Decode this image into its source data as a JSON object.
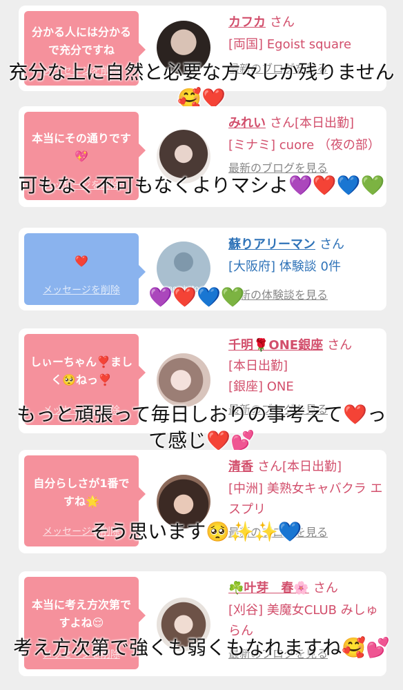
{
  "cards": [
    {
      "message": "分かる人には分かるで充分ですね",
      "delete_label": "メッセージを削除",
      "name": "カフカ",
      "suffix": "さん",
      "lines": [
        "[両国] Egoist square"
      ],
      "link": "最新のブログを見る",
      "overlay": "充分な上に自然と必要な方々しか残りません🥰❤️"
    },
    {
      "message": "本当にその通りです💖",
      "delete_label": "メッセージを削除",
      "name": "みれい",
      "suffix": "さん[本日出勤]",
      "lines": [
        "[ミナミ] cuore （夜の部）"
      ],
      "link": "最新のブログを見る",
      "overlay": "可もなく不可もなくよりマシよ💜❤️💙💚"
    },
    {
      "message": "❤️",
      "delete_label": "メッセージを削除",
      "name": "蘇りアリーマン",
      "suffix": "さん",
      "lines": [
        "[大阪府] 体験談 0件"
      ],
      "link": "最新の体験談を見る",
      "overlay": "💜❤️💙💚",
      "avatar_text": "no photo"
    },
    {
      "message": "しぃーちゃん❣️ましく🥺ねっ❣️",
      "delete_label": "メッセージを削除",
      "name": "千明🌹ONE銀座",
      "suffix": "さん",
      "lines": [
        "[本日出勤]",
        "[銀座] ONE"
      ],
      "link": "最新のブログを見る",
      "overlay": "もっと頑張って毎日しおりの事考えて❤️って感じ❤️💕"
    },
    {
      "message": "自分らしさが1番ですね🌟",
      "delete_label": "メッセージを削除",
      "name": "清香",
      "suffix": "さん[本日出勤]",
      "lines": [
        "[中洲] 美熟女キャバクラ エスプリ"
      ],
      "link": "最新のブログを見る",
      "overlay": "そう思います🥺✨✨💙"
    },
    {
      "message": "本当に考え方次第ですよね😌",
      "delete_label": "メッセージを削除",
      "name": "☘️叶芽　春🌸",
      "suffix": "さん",
      "lines": [
        "[刈谷] 美魔女CLUB みしゅらん"
      ],
      "link": "最新のブログを見る",
      "overlay": "考え方次第で強くも弱くもなれますね🥰💕"
    }
  ],
  "colors": {
    "pink_bubble": "#f5919c",
    "blue_bubble": "#8ab3ee",
    "name_pink": "#d24f6c",
    "name_blue": "#2f73b8"
  }
}
